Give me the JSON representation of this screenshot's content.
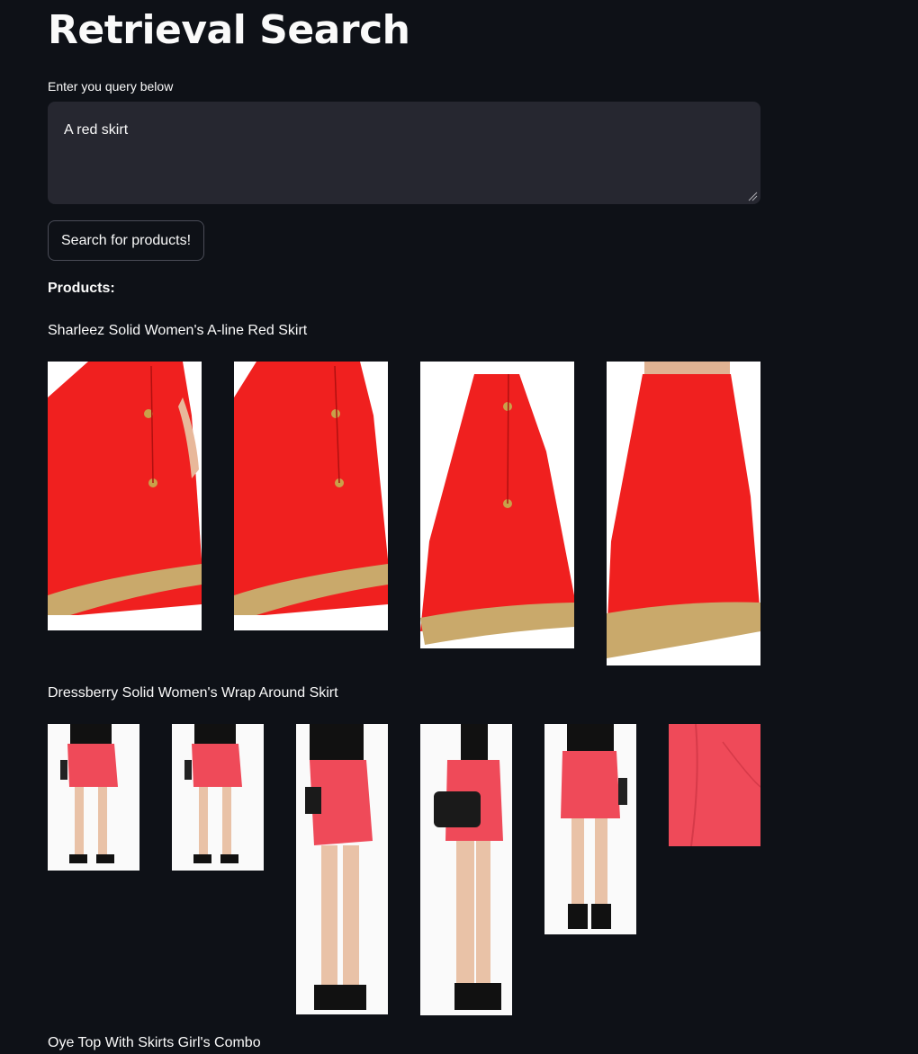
{
  "page": {
    "title": "Retrieval Search",
    "query_label": "Enter you query below",
    "query_value": "A red skirt",
    "search_button": "Search for products!",
    "products_heading": "Products:"
  },
  "products": [
    {
      "name": "Sharleez Solid Women's A-line Red Skirt",
      "images": [
        "red A-line skirt with tassels, front",
        "red A-line skirt with tassels, front",
        "red A-line skirt, side view",
        "red A-line skirt, back view"
      ]
    },
    {
      "name": "Dressberry Solid Women's Wrap Around Skirt",
      "images": [
        "pink wrap skirt, full front",
        "pink wrap skirt, full front",
        "pink wrap skirt, side view",
        "pink wrap skirt, side with bag",
        "pink wrap skirt, back view",
        "pink fabric close-up"
      ]
    },
    {
      "name": "Oye Top With Skirts Girl's Combo",
      "images": []
    }
  ],
  "colors": {
    "background": "#0e1117",
    "input_bg": "#262730",
    "text": "#fafafa",
    "skirt_red": "#f0201f",
    "skirt_pink": "#ef4a59",
    "gold_border": "#c9a96b"
  }
}
